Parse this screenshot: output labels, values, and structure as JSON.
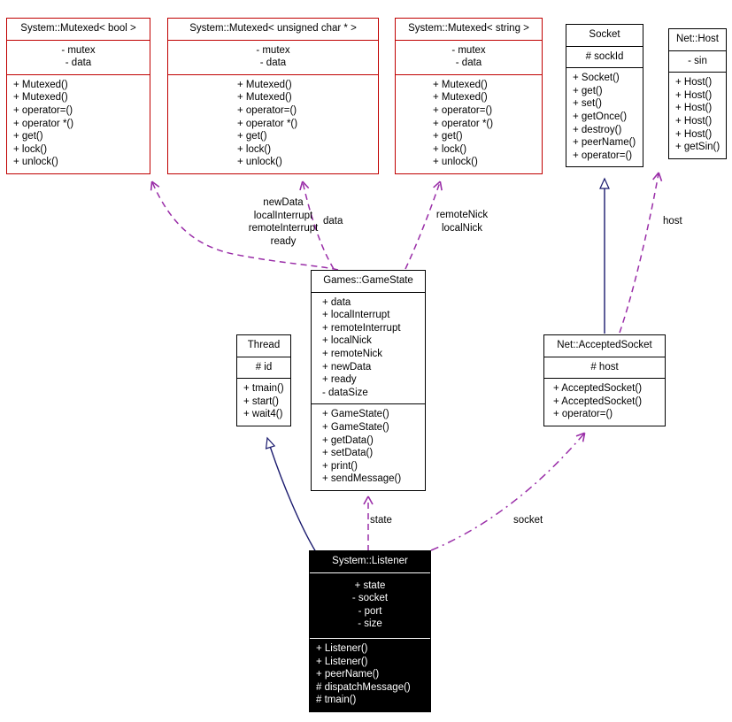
{
  "diagram": {
    "kind": "uml-class-diagram",
    "colors": {
      "template_class_border": "#c00000",
      "plain_class_border": "#000000",
      "highlighted_class_fill": "#000000",
      "highlighted_class_text": "#ffffff",
      "usage_edge": "#9a2ea8",
      "inheritance_edge": "#1a1a6e",
      "background": "#ffffff"
    }
  },
  "classes": {
    "mutexed_bool": {
      "title": "System::Mutexed< bool >",
      "attributes": [
        "- mutex",
        "- data"
      ],
      "operations": [
        "+ Mutexed()",
        "+ Mutexed()",
        "+ operator=()",
        "+ operator *()",
        "+ get()",
        "+ lock()",
        "+ unlock()"
      ]
    },
    "mutexed_uchar": {
      "title": "System::Mutexed< unsigned char * >",
      "attributes": [
        "- mutex",
        "- data"
      ],
      "operations": [
        "+ Mutexed()",
        "+ Mutexed()",
        "+ operator=()",
        "+ operator *()",
        "+ get()",
        "+ lock()",
        "+ unlock()"
      ]
    },
    "mutexed_string": {
      "title": "System::Mutexed< string >",
      "attributes": [
        "- mutex",
        "- data"
      ],
      "operations": [
        "+ Mutexed()",
        "+ Mutexed()",
        "+ operator=()",
        "+ operator *()",
        "+ get()",
        "+ lock()",
        "+ unlock()"
      ]
    },
    "socket": {
      "title": "Socket",
      "attributes": [
        "# sockId"
      ],
      "operations": [
        "+ Socket()",
        "+ get()",
        "+ set()",
        "+ getOnce()",
        "+ destroy()",
        "+ peerName()",
        "+ operator=()"
      ]
    },
    "host": {
      "title": "Net::Host",
      "attributes": [
        "- sin"
      ],
      "operations": [
        "+ Host()",
        "+ Host()",
        "+ Host()",
        "+ Host()",
        "+ Host()",
        "+ getSin()"
      ]
    },
    "gamestate": {
      "title": "Games::GameState",
      "attributes": [
        "+ data",
        "+ localInterrupt",
        "+ remoteInterrupt",
        "+ localNick",
        "+ remoteNick",
        "+ newData",
        "+ ready",
        "- dataSize"
      ],
      "operations": [
        "+ GameState()",
        "+ GameState()",
        "+ getData()",
        "+ setData()",
        "+ print()",
        "+ sendMessage()"
      ]
    },
    "thread": {
      "title": "Thread",
      "attributes": [
        "# id"
      ],
      "operations": [
        "+ tmain()",
        "+ start()",
        "+ wait4()"
      ]
    },
    "accepted_socket": {
      "title": "Net::AcceptedSocket",
      "attributes": [
        "# host"
      ],
      "operations": [
        "+ AcceptedSocket()",
        "+ AcceptedSocket()",
        "+ operator=()"
      ]
    },
    "listener": {
      "title": "System::Listener",
      "attributes": [
        "+ state",
        "- socket",
        "- port",
        "- size"
      ],
      "operations": [
        "+ Listener()",
        "+ Listener()",
        "+ peerName()",
        "# dispatchMessage()",
        "# tmain()"
      ]
    }
  },
  "edge_labels": {
    "gamestate_to_mutexed_bool": "newData\nlocalInterrupt\nremoteInterrupt\nready",
    "gamestate_to_mutexed_bool_lines": [
      "newData",
      "localInterrupt",
      "remoteInterrupt",
      "ready"
    ],
    "gamestate_to_mutexed_uchar": "data",
    "gamestate_to_mutexed_string_lines": [
      "remoteNick",
      "localNick"
    ],
    "accepted_socket_to_host": "host",
    "listener_to_gamestate": "state",
    "listener_to_accepted_socket": "socket"
  }
}
